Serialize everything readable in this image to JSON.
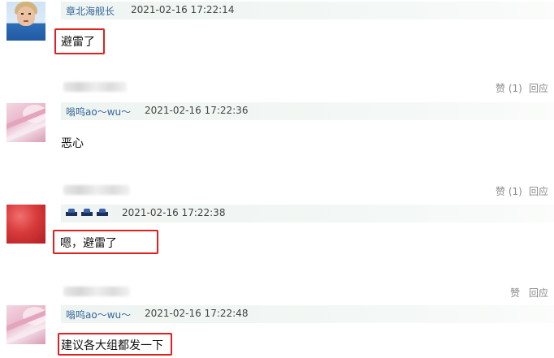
{
  "comments": [
    {
      "username": "章北海舰长",
      "timestamp": "2021-02-16 17:22:14",
      "content": "避雷了",
      "avatar": "woman-avatar"
    },
    {
      "username": "嗡呜ao～wu～",
      "timestamp": "2021-02-16 17:22:36",
      "content": "恶心",
      "avatar": "anime-avatar"
    },
    {
      "username": "",
      "timestamp": "2021-02-16 17:22:38",
      "content": "嗯，避雷了",
      "avatar": "red-avatar"
    },
    {
      "username": "嗡呜ao～wu～",
      "timestamp": "2021-02-16 17:22:48",
      "content": "建议各大组都发一下",
      "avatar": "anime-avatar"
    }
  ],
  "actions": {
    "like_with_count": "赞 (1)",
    "like": "赞",
    "reply": "回应"
  },
  "colors": {
    "username": "#336699",
    "highlight_box": "#e02020",
    "header_bg": "#eef4f1"
  }
}
